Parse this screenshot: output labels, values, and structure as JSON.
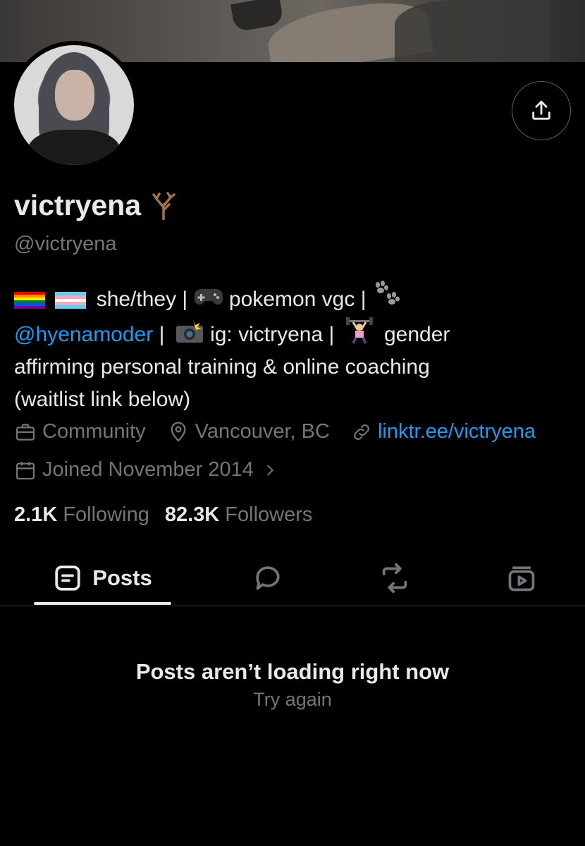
{
  "profile": {
    "display_name": "victryena",
    "handle": "@victryena",
    "name_emoji": "🪾"
  },
  "bio": {
    "line1_text": "she/they |",
    "line1_game_text": "pokemon vgc |",
    "line2_mention": "@hyenamoder",
    "line2_sep": " |",
    "line2_ig": "ig: victryena |",
    "line2_gender": "gender",
    "line3": "affirming personal training & online coaching",
    "line4": "(waitlist link below)"
  },
  "meta": {
    "category": "Community",
    "location": "Vancouver, BC",
    "website": "linktr.ee/victryena",
    "joined": "Joined November 2014"
  },
  "stats": {
    "following_count": "2.1K",
    "following_label": "Following",
    "followers_count": "82.3K",
    "followers_label": "Followers"
  },
  "tabs": {
    "posts_label": "Posts"
  },
  "feed": {
    "error_title": "Posts aren’t loading right now",
    "retry_label": "Try again"
  },
  "colors": {
    "background": "#000000",
    "text_primary": "#e7e9ea",
    "text_secondary": "#71767b",
    "link": "#1d9bf0",
    "border": "#2f3336"
  }
}
